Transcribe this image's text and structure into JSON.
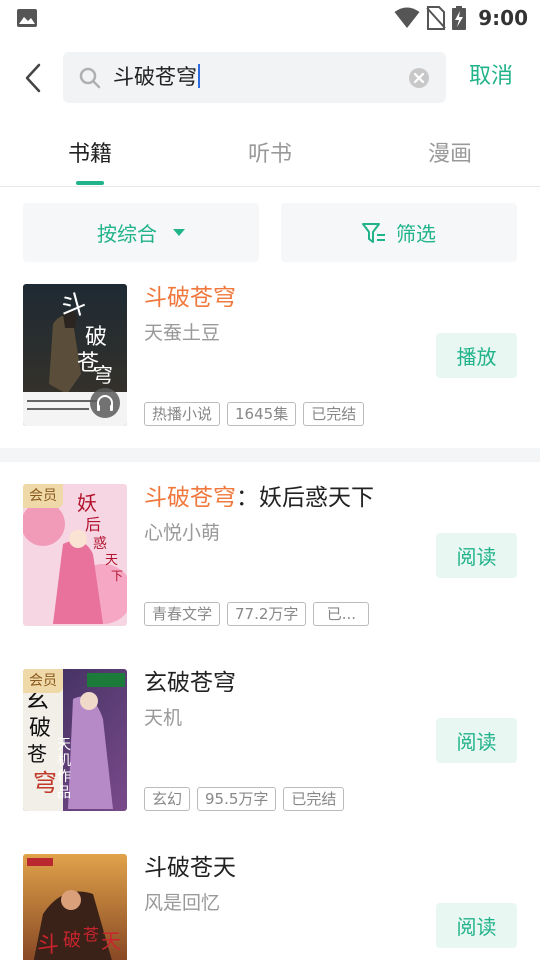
{
  "status_bar": {
    "time": "9:00"
  },
  "search": {
    "query": "斗破苍穹",
    "cancel_label": "取消"
  },
  "tabs": [
    {
      "label": "书籍",
      "active": true
    },
    {
      "label": "听书",
      "active": false
    },
    {
      "label": "漫画",
      "active": false
    }
  ],
  "filters": {
    "sort_label": "按综合",
    "filter_label": "筛选"
  },
  "results": [
    {
      "title_highlight": "斗破苍穹",
      "title_rest": "",
      "author": "天蚕土豆",
      "tags": [
        "热播小说",
        "1645集",
        "已完结"
      ],
      "action": "播放",
      "vip": false
    },
    {
      "title_highlight": "斗破苍穹",
      "title_rest": "：妖后惑天下",
      "author": "心悦小萌",
      "tags": [
        "青春文学",
        "77.2万字",
        "已..."
      ],
      "action": "阅读",
      "vip": true,
      "vip_label": "会员"
    },
    {
      "title_highlight": "",
      "title_rest": "玄破苍穹",
      "author": "天机",
      "tags": [
        "玄幻",
        "95.5万字",
        "已完结"
      ],
      "action": "阅读",
      "vip": true,
      "vip_label": "会员"
    },
    {
      "title_highlight": "",
      "title_rest": "斗破苍天",
      "author": "风是回忆",
      "tags": [],
      "action": "阅读",
      "vip": false
    }
  ],
  "colors": {
    "accent": "#21b38a",
    "highlight": "#f0783c",
    "vip": "#f0d9a8"
  }
}
